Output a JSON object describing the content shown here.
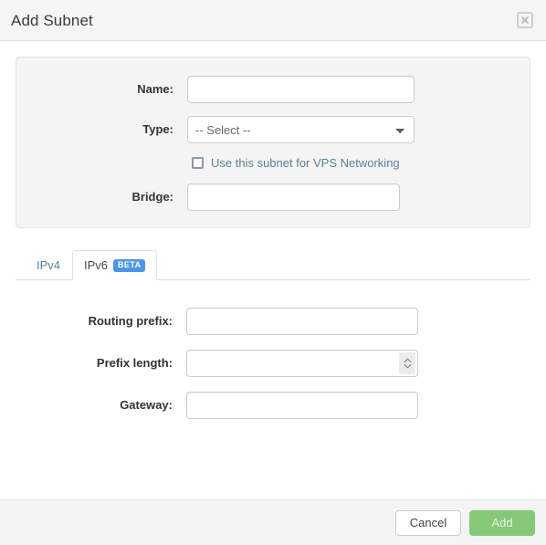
{
  "header": {
    "title": "Add Subnet",
    "close_icon": "close-icon"
  },
  "form": {
    "name": {
      "label": "Name:",
      "value": "",
      "placeholder": ""
    },
    "type": {
      "label": "Type:",
      "selected": "-- Select --",
      "options": [
        "-- Select --"
      ]
    },
    "vps_checkbox": {
      "label": "Use this subnet for VPS Networking",
      "checked": false
    },
    "bridge": {
      "label": "Bridge:",
      "value": "",
      "placeholder": ""
    }
  },
  "tabs": {
    "active": "IPv6",
    "items": [
      {
        "label": "IPv4",
        "badge": "",
        "active": false
      },
      {
        "label": "IPv6",
        "badge": "BETA",
        "active": true
      }
    ]
  },
  "ipv6_panel": {
    "routing_prefix": {
      "label": "Routing prefix:",
      "value": "",
      "placeholder": ""
    },
    "prefix_length": {
      "label": "Prefix length:",
      "value": "",
      "placeholder": "",
      "spinner_icon": "spinner-up-down-icon"
    },
    "gateway": {
      "label": "Gateway:",
      "value": "",
      "placeholder": ""
    }
  },
  "footer": {
    "cancel_label": "Cancel",
    "add_label": "Add"
  },
  "colors": {
    "accent_blue": "#4b96e6",
    "link_blue": "#5c7f95",
    "add_green": "#86c877",
    "panel_grey": "#f4f4f4",
    "border_grey": "#dddddd"
  }
}
